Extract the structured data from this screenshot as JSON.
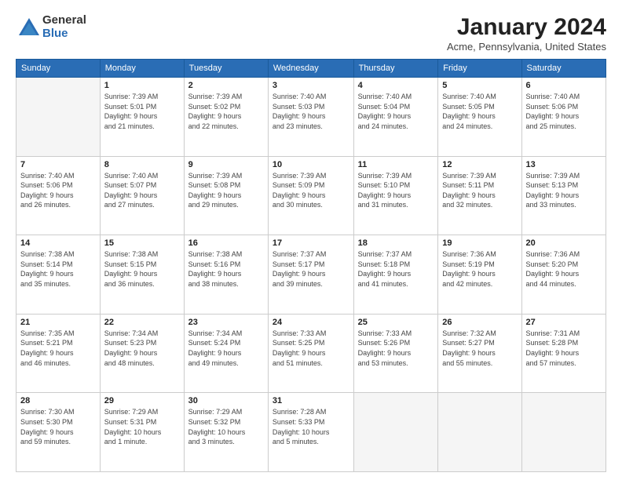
{
  "logo": {
    "general": "General",
    "blue": "Blue"
  },
  "title": "January 2024",
  "location": "Acme, Pennsylvania, United States",
  "headers": [
    "Sunday",
    "Monday",
    "Tuesday",
    "Wednesday",
    "Thursday",
    "Friday",
    "Saturday"
  ],
  "weeks": [
    [
      {
        "day": "",
        "info": ""
      },
      {
        "day": "1",
        "info": "Sunrise: 7:39 AM\nSunset: 5:01 PM\nDaylight: 9 hours\nand 21 minutes."
      },
      {
        "day": "2",
        "info": "Sunrise: 7:39 AM\nSunset: 5:02 PM\nDaylight: 9 hours\nand 22 minutes."
      },
      {
        "day": "3",
        "info": "Sunrise: 7:40 AM\nSunset: 5:03 PM\nDaylight: 9 hours\nand 23 minutes."
      },
      {
        "day": "4",
        "info": "Sunrise: 7:40 AM\nSunset: 5:04 PM\nDaylight: 9 hours\nand 24 minutes."
      },
      {
        "day": "5",
        "info": "Sunrise: 7:40 AM\nSunset: 5:05 PM\nDaylight: 9 hours\nand 24 minutes."
      },
      {
        "day": "6",
        "info": "Sunrise: 7:40 AM\nSunset: 5:06 PM\nDaylight: 9 hours\nand 25 minutes."
      }
    ],
    [
      {
        "day": "7",
        "info": "Sunrise: 7:40 AM\nSunset: 5:06 PM\nDaylight: 9 hours\nand 26 minutes."
      },
      {
        "day": "8",
        "info": "Sunrise: 7:40 AM\nSunset: 5:07 PM\nDaylight: 9 hours\nand 27 minutes."
      },
      {
        "day": "9",
        "info": "Sunrise: 7:39 AM\nSunset: 5:08 PM\nDaylight: 9 hours\nand 29 minutes."
      },
      {
        "day": "10",
        "info": "Sunrise: 7:39 AM\nSunset: 5:09 PM\nDaylight: 9 hours\nand 30 minutes."
      },
      {
        "day": "11",
        "info": "Sunrise: 7:39 AM\nSunset: 5:10 PM\nDaylight: 9 hours\nand 31 minutes."
      },
      {
        "day": "12",
        "info": "Sunrise: 7:39 AM\nSunset: 5:11 PM\nDaylight: 9 hours\nand 32 minutes."
      },
      {
        "day": "13",
        "info": "Sunrise: 7:39 AM\nSunset: 5:13 PM\nDaylight: 9 hours\nand 33 minutes."
      }
    ],
    [
      {
        "day": "14",
        "info": "Sunrise: 7:38 AM\nSunset: 5:14 PM\nDaylight: 9 hours\nand 35 minutes."
      },
      {
        "day": "15",
        "info": "Sunrise: 7:38 AM\nSunset: 5:15 PM\nDaylight: 9 hours\nand 36 minutes."
      },
      {
        "day": "16",
        "info": "Sunrise: 7:38 AM\nSunset: 5:16 PM\nDaylight: 9 hours\nand 38 minutes."
      },
      {
        "day": "17",
        "info": "Sunrise: 7:37 AM\nSunset: 5:17 PM\nDaylight: 9 hours\nand 39 minutes."
      },
      {
        "day": "18",
        "info": "Sunrise: 7:37 AM\nSunset: 5:18 PM\nDaylight: 9 hours\nand 41 minutes."
      },
      {
        "day": "19",
        "info": "Sunrise: 7:36 AM\nSunset: 5:19 PM\nDaylight: 9 hours\nand 42 minutes."
      },
      {
        "day": "20",
        "info": "Sunrise: 7:36 AM\nSunset: 5:20 PM\nDaylight: 9 hours\nand 44 minutes."
      }
    ],
    [
      {
        "day": "21",
        "info": "Sunrise: 7:35 AM\nSunset: 5:21 PM\nDaylight: 9 hours\nand 46 minutes."
      },
      {
        "day": "22",
        "info": "Sunrise: 7:34 AM\nSunset: 5:23 PM\nDaylight: 9 hours\nand 48 minutes."
      },
      {
        "day": "23",
        "info": "Sunrise: 7:34 AM\nSunset: 5:24 PM\nDaylight: 9 hours\nand 49 minutes."
      },
      {
        "day": "24",
        "info": "Sunrise: 7:33 AM\nSunset: 5:25 PM\nDaylight: 9 hours\nand 51 minutes."
      },
      {
        "day": "25",
        "info": "Sunrise: 7:33 AM\nSunset: 5:26 PM\nDaylight: 9 hours\nand 53 minutes."
      },
      {
        "day": "26",
        "info": "Sunrise: 7:32 AM\nSunset: 5:27 PM\nDaylight: 9 hours\nand 55 minutes."
      },
      {
        "day": "27",
        "info": "Sunrise: 7:31 AM\nSunset: 5:28 PM\nDaylight: 9 hours\nand 57 minutes."
      }
    ],
    [
      {
        "day": "28",
        "info": "Sunrise: 7:30 AM\nSunset: 5:30 PM\nDaylight: 9 hours\nand 59 minutes."
      },
      {
        "day": "29",
        "info": "Sunrise: 7:29 AM\nSunset: 5:31 PM\nDaylight: 10 hours\nand 1 minute."
      },
      {
        "day": "30",
        "info": "Sunrise: 7:29 AM\nSunset: 5:32 PM\nDaylight: 10 hours\nand 3 minutes."
      },
      {
        "day": "31",
        "info": "Sunrise: 7:28 AM\nSunset: 5:33 PM\nDaylight: 10 hours\nand 5 minutes."
      },
      {
        "day": "",
        "info": ""
      },
      {
        "day": "",
        "info": ""
      },
      {
        "day": "",
        "info": ""
      }
    ]
  ]
}
